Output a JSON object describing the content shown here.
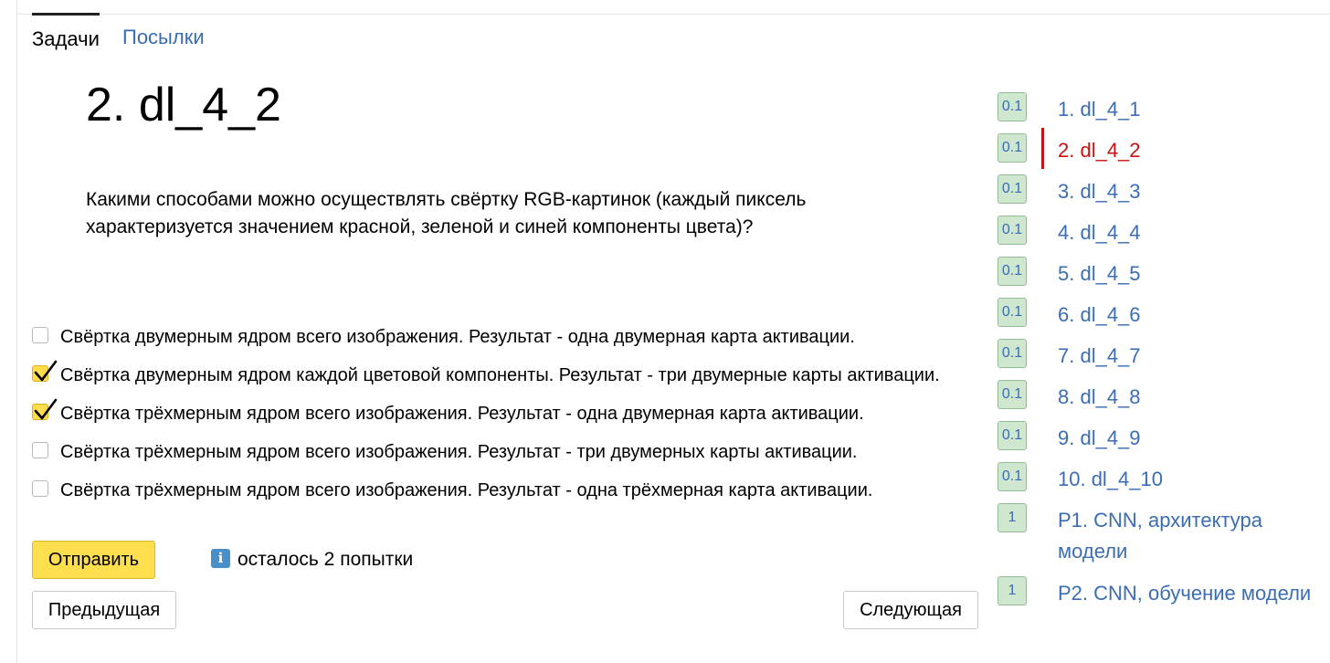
{
  "tabs": {
    "tasks": "Задачи",
    "submissions": "Посылки"
  },
  "problem": {
    "title": "2. dl_4_2",
    "statement": "Какими способами можно осуществлять свёртку RGB-картинок (каждый пиксель характеризуется значением красной, зеленой и синей компоненты цвета)?"
  },
  "options": [
    {
      "label": "Свёртка двумерным ядром всего изображения. Результат - одна двумерная карта активации.",
      "checked": false
    },
    {
      "label": "Свёртка двумерным ядром каждой цветовой компоненты. Результат - три двумерные карты активации.",
      "checked": true
    },
    {
      "label": "Свёртка трёхмерным ядром всего изображения. Результат - одна двумерная карта активации.",
      "checked": true
    },
    {
      "label": "Свёртка трёхмерным ядром всего изображения. Результат - три двумерных карты активации.",
      "checked": false
    },
    {
      "label": "Свёртка трёхмерным ядром всего изображения. Результат - одна трёхмерная карта активации.",
      "checked": false
    }
  ],
  "actions": {
    "submit": "Отправить",
    "attempts": "осталось 2 попытки",
    "prev": "Предыдущая",
    "next": "Следующая"
  },
  "nav": [
    {
      "score": "0.1",
      "label": "1. dl_4_1",
      "active": false
    },
    {
      "score": "0.1",
      "label": "2. dl_4_2",
      "active": true
    },
    {
      "score": "0.1",
      "label": "3. dl_4_3",
      "active": false
    },
    {
      "score": "0.1",
      "label": "4. dl_4_4",
      "active": false
    },
    {
      "score": "0.1",
      "label": "5. dl_4_5",
      "active": false
    },
    {
      "score": "0.1",
      "label": "6. dl_4_6",
      "active": false
    },
    {
      "score": "0.1",
      "label": "7. dl_4_7",
      "active": false
    },
    {
      "score": "0.1",
      "label": "8. dl_4_8",
      "active": false
    },
    {
      "score": "0.1",
      "label": "9. dl_4_9",
      "active": false
    },
    {
      "score": "0.1",
      "label": "10. dl_4_10",
      "active": false
    },
    {
      "score": "1",
      "label": "P1. CNN, архитектура модели",
      "active": false
    },
    {
      "score": "1",
      "label": "P2. CNN, обучение модели",
      "active": false
    }
  ],
  "colors": {
    "link": "#3a6db5",
    "active": "#cc1010",
    "accent": "#fdde4d",
    "badge_bg": "#cfe6cf"
  },
  "icons": {
    "info": "info-icon",
    "check": "checkmark-icon"
  }
}
